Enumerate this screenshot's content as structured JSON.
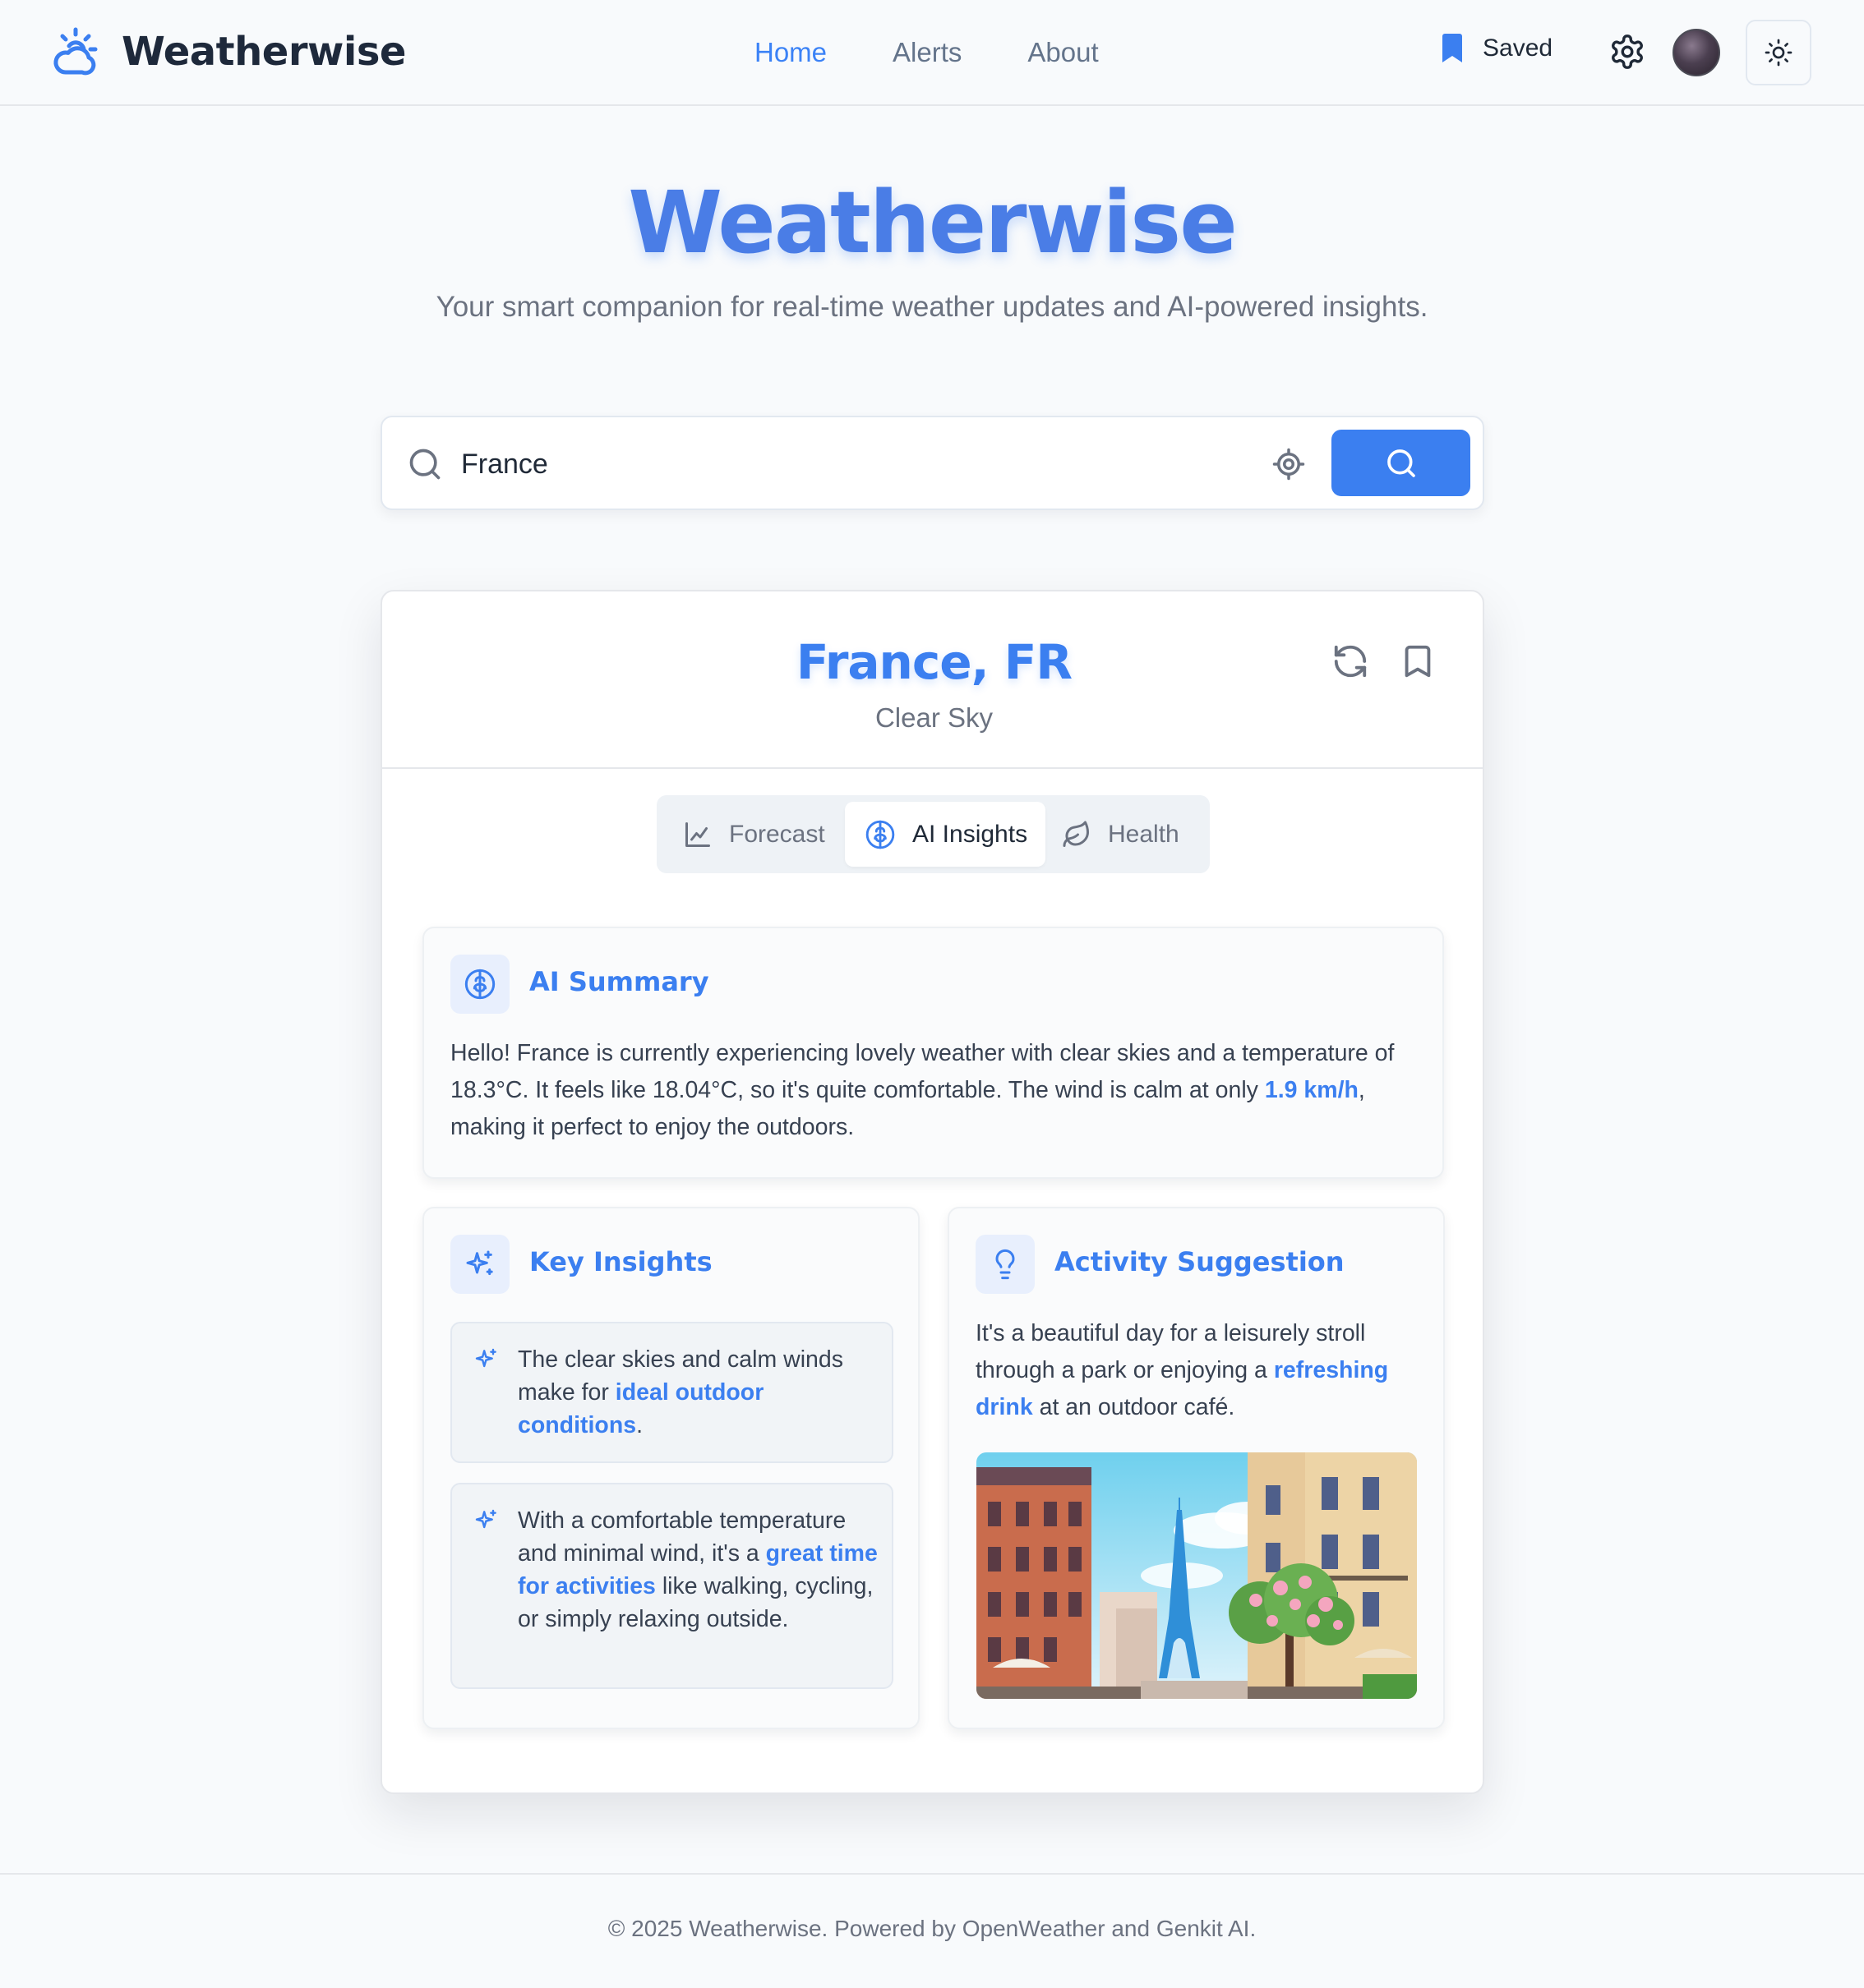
{
  "header": {
    "brand": "Weatherwise",
    "nav": [
      {
        "label": "Home",
        "active": true
      },
      {
        "label": "Alerts",
        "active": false
      },
      {
        "label": "About",
        "active": false
      }
    ],
    "saved_label": "Saved"
  },
  "hero": {
    "title": "Weatherwise",
    "subtitle": "Your smart companion for real-time weather updates and AI-powered insights."
  },
  "search": {
    "value": "France"
  },
  "location": {
    "title": "France, FR",
    "condition": "Clear Sky"
  },
  "tabs": [
    {
      "label": "Forecast",
      "icon": "chart-icon",
      "active": false
    },
    {
      "label": "AI Insights",
      "icon": "brain-icon",
      "active": true
    },
    {
      "label": "Health",
      "icon": "leaf-icon",
      "active": false
    }
  ],
  "summary": {
    "title": "AI Summary",
    "text_part1": "Hello! France is currently experiencing lovely weather with clear skies and a temperature of 18.3°C. It feels like 18.04°C, so it's quite comfortable. The wind is calm at only ",
    "text_highlight": "1.9 km/h",
    "text_part2": ", making it perfect to enjoy the outdoors."
  },
  "insights": {
    "title": "Key Insights",
    "items": [
      {
        "pre": "The clear skies and calm winds make for ",
        "highlight": "ideal outdoor conditions",
        "post": "."
      },
      {
        "pre": "With a comfortable temperature and minimal wind, it's a ",
        "highlight": "great time for activities",
        "post": " like walking, cycling, or simply relaxing outside."
      }
    ]
  },
  "activity": {
    "title": "Activity Suggestion",
    "pre": "It's a beautiful day for a leisurely stroll through a park or enjoying a ",
    "highlight": "refreshing drink",
    "post": " at an outdoor café."
  },
  "footer": {
    "text": "© 2025 Weatherwise. Powered by OpenWeather and Genkit AI."
  },
  "colors": {
    "accent": "#3b7ff0",
    "background": "#f8fafc",
    "text": "#374151",
    "muted": "#6b7280"
  }
}
